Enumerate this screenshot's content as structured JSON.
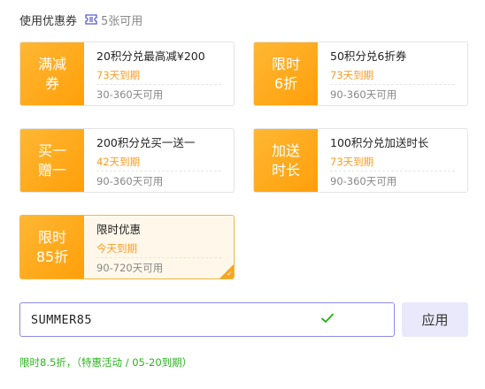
{
  "header": {
    "title": "使用优惠券",
    "count": "5张可用"
  },
  "coupons": [
    {
      "badge": "满减\n券",
      "name": "20积分兑最高减¥200",
      "expire": "73天到期",
      "days": "30-360天可用",
      "selected": false
    },
    {
      "badge": "限时\n6折",
      "name": "50积分兑6折券",
      "expire": "73天到期",
      "days": "90-360天可用",
      "selected": false
    },
    {
      "badge": "买一\n赠一",
      "name": "200积分兑买一送一",
      "expire": "42天到期",
      "days": "90-360天可用",
      "selected": false
    },
    {
      "badge": "加送\n时长",
      "name": "100积分兑加送时长",
      "expire": "73天到期",
      "days": "90-360天可用",
      "selected": false
    },
    {
      "badge": "限时\n85折",
      "name": "限时优惠",
      "expire": "今天到期",
      "days": "90-720天可用",
      "selected": true
    }
  ],
  "promo": {
    "value": "SUMMER85",
    "apply_label": "应用",
    "status": "限时8.5折，（特惠活动 / 05-20到期）"
  },
  "colors": {
    "badge": "#ffa81a",
    "accent_border": "#8c8ce6",
    "success": "#2bb51e",
    "expire": "#ff9a1f"
  }
}
